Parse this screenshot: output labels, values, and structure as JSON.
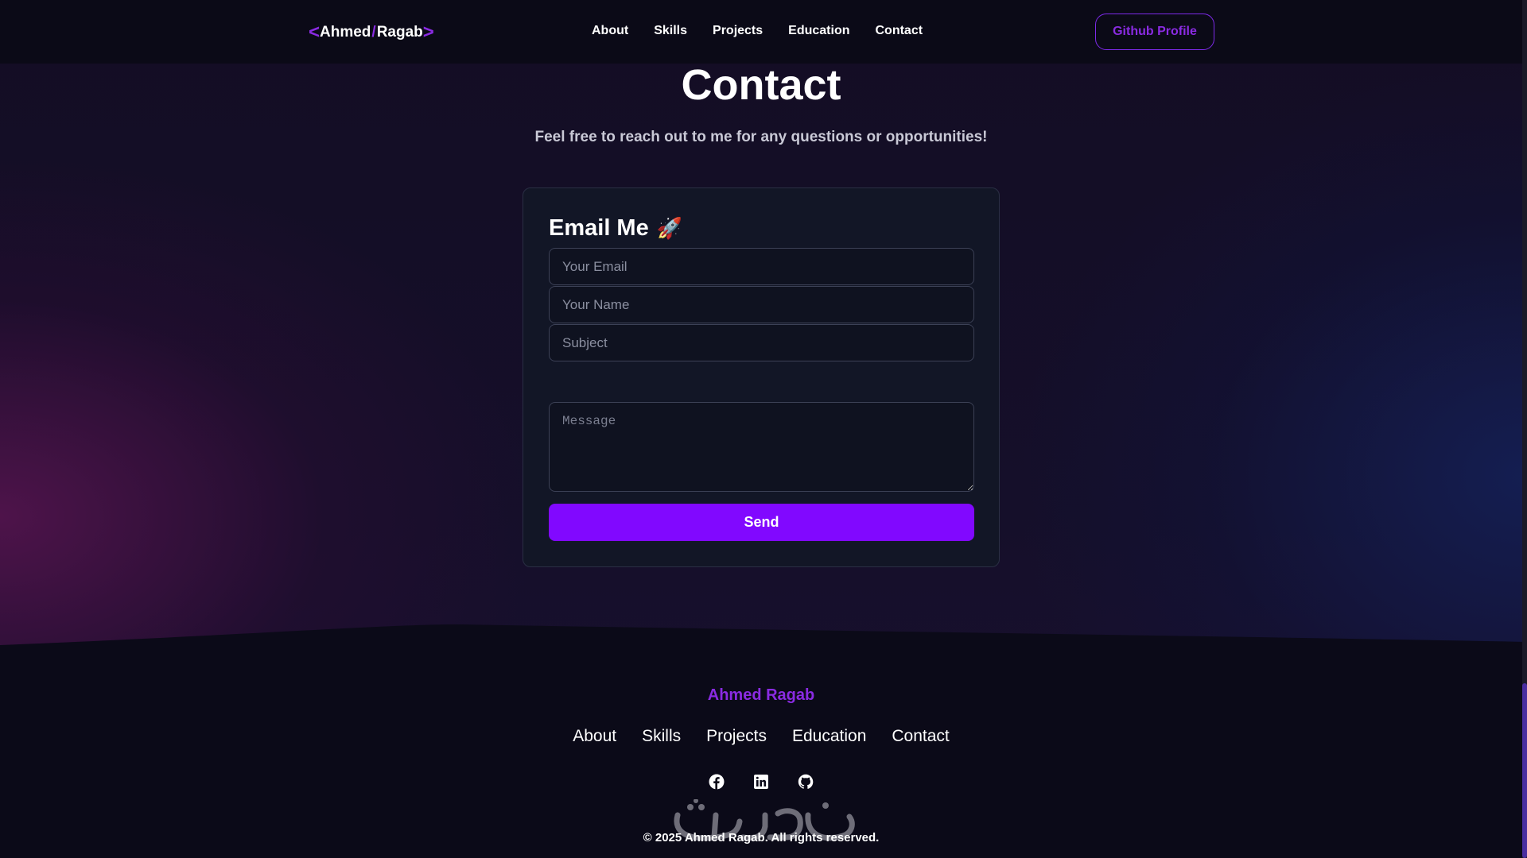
{
  "nav": {
    "logo": {
      "first": "Ahmed",
      "slash": "/",
      "last": "Ragab",
      "left_chevron": "<",
      "right_chevron": ">"
    },
    "links": [
      "About",
      "Skills",
      "Projects",
      "Education",
      "Contact"
    ],
    "github_button": "Github Profile"
  },
  "header": {
    "title": "Contact",
    "subtitle": "Feel free to reach out to me for any questions or opportunities!"
  },
  "form": {
    "title": "Email Me",
    "title_icon": "🚀",
    "email_placeholder": "Your Email",
    "name_placeholder": "Your Name",
    "subject_placeholder": "Subject",
    "message_placeholder": "Message",
    "send_label": "Send"
  },
  "footer": {
    "brand": "Ahmed Ragab",
    "links": [
      "About",
      "Skills",
      "Projects",
      "Education",
      "Contact"
    ],
    "social": [
      "facebook-icon",
      "linkedin-icon",
      "github-icon"
    ],
    "copyright": "© 2025 Ahmed Ragab. All rights reserved."
  },
  "colors": {
    "accent": "#8a2be2",
    "send_button": "#8108ff",
    "background": "#0b0a18",
    "card": "#121626"
  }
}
